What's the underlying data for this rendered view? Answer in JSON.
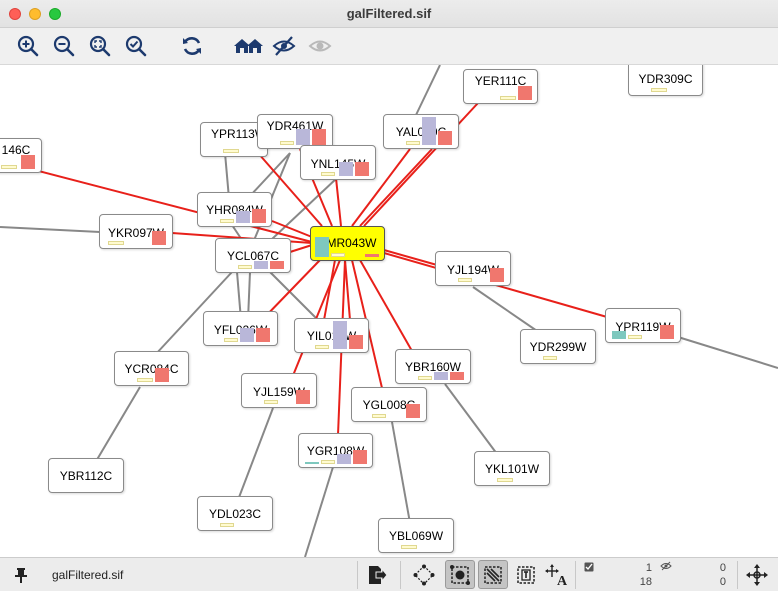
{
  "window": {
    "title": "galFiltered.sif"
  },
  "toolbar": {
    "buttons": [
      {
        "name": "zoom-in-icon"
      },
      {
        "name": "zoom-out-icon"
      },
      {
        "name": "zoom-fit-icon"
      },
      {
        "name": "zoom-selected-icon"
      },
      {
        "name": "refresh-icon"
      },
      {
        "name": "home-icon"
      },
      {
        "name": "hide-icon"
      },
      {
        "name": "show-icon"
      }
    ]
  },
  "network": {
    "nodes": [
      {
        "label": "146C"
      },
      {
        "label": "YER111C"
      },
      {
        "label": "YDR309C"
      },
      {
        "label": "YPR113W"
      },
      {
        "label": "YDR461W"
      },
      {
        "label": "YAL040C"
      },
      {
        "label": "YNL145W"
      },
      {
        "label": "YHR084W"
      },
      {
        "label": "YKR097W"
      },
      {
        "label": "YMR043W",
        "selected": true
      },
      {
        "label": "YCL067C"
      },
      {
        "label": "YJL194W"
      },
      {
        "label": "YPR119W"
      },
      {
        "label": "YFL026W"
      },
      {
        "label": "YIL015W"
      },
      {
        "label": "YDR299W"
      },
      {
        "label": "YCR084C"
      },
      {
        "label": "YBR160W"
      },
      {
        "label": "YJL159W"
      },
      {
        "label": "YGL008C"
      },
      {
        "label": "YGR108W"
      },
      {
        "label": "YBR112C"
      },
      {
        "label": "YKL101W"
      },
      {
        "label": "YDL023C"
      },
      {
        "label": "YBL069W"
      }
    ],
    "colors": {
      "edge_highlight": "#e8201a",
      "edge_normal": "#888888",
      "selected_fill": "#ffff00"
    }
  },
  "status": {
    "file_name": "galFiltered.sif",
    "selected_nodes": "1",
    "total_nodes": "18",
    "hidden_nodes": "0",
    "hidden_edges": "0"
  }
}
